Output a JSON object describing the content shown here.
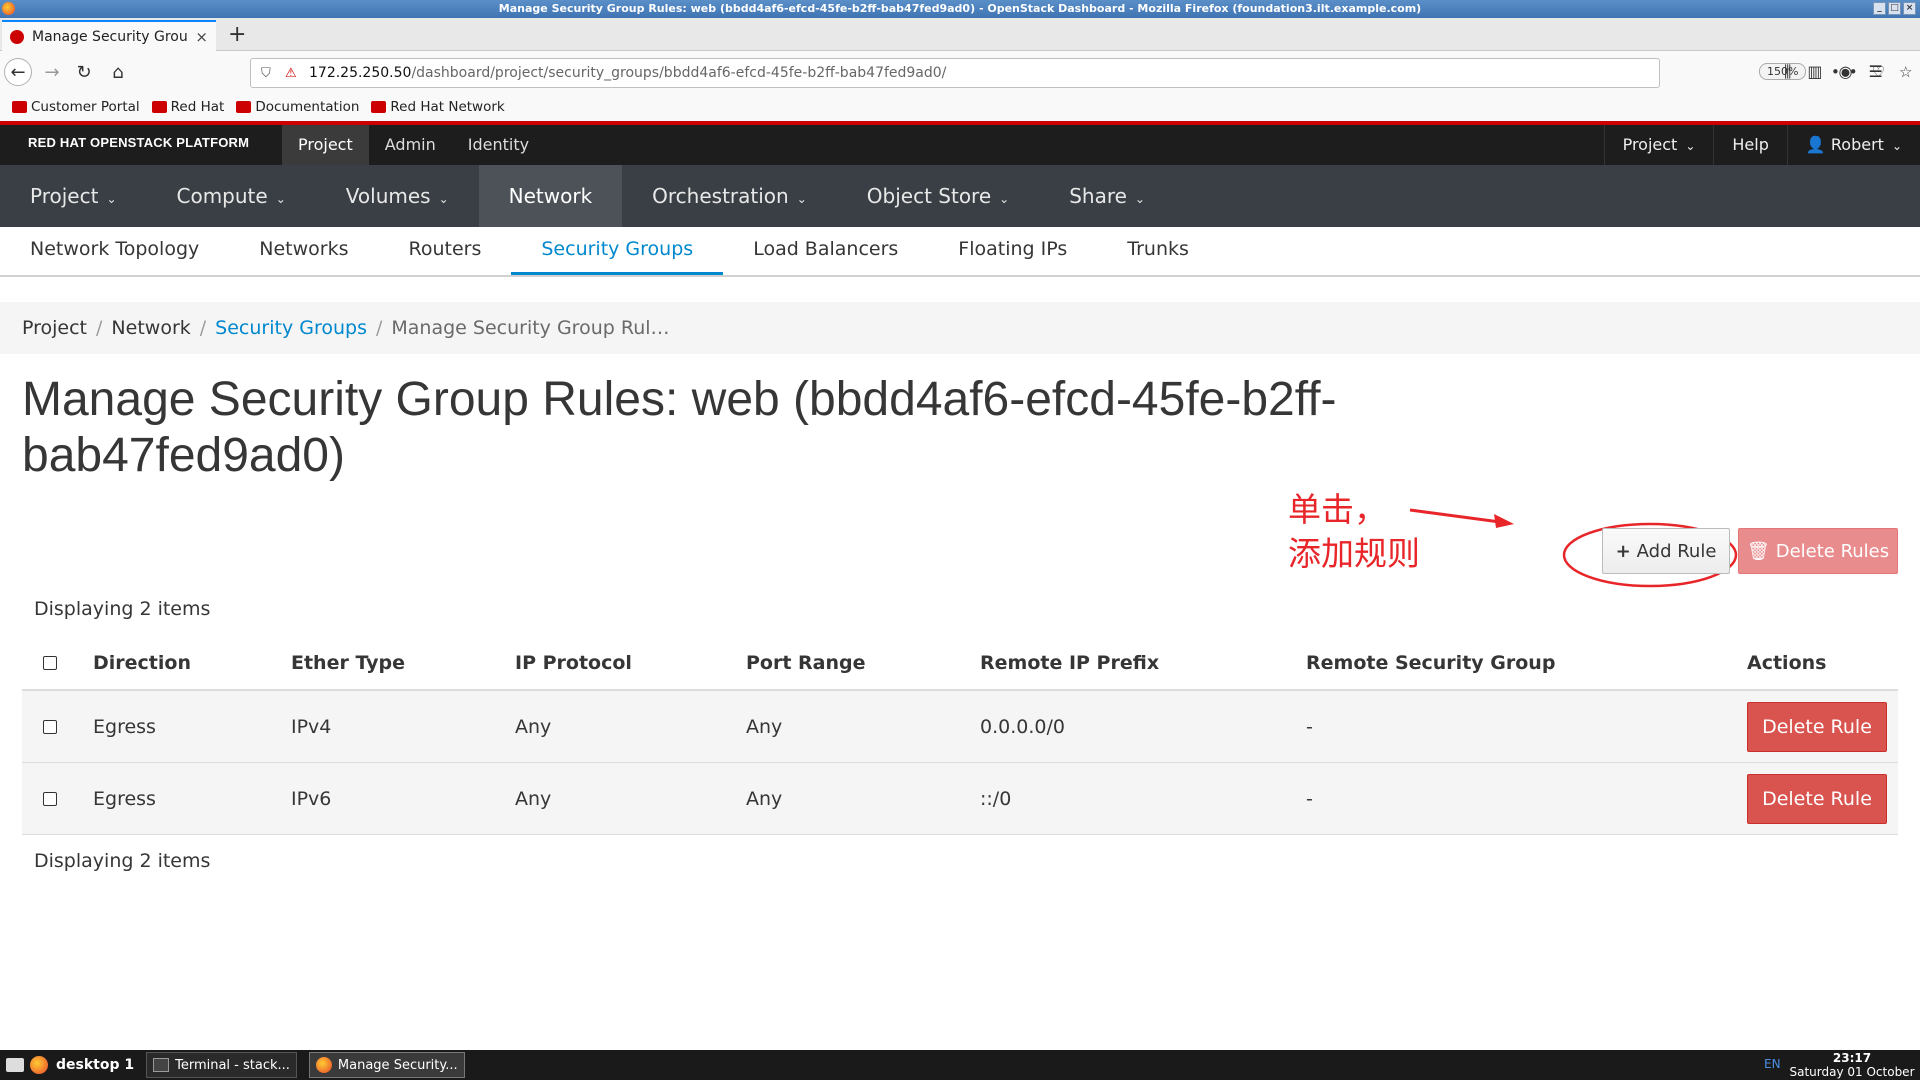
{
  "window": {
    "title": "Manage Security Group Rules: web (bbdd4af6-efcd-45fe-b2ff-bab47fed9ad0) - OpenStack Dashboard - Mozilla Firefox (foundation3.ilt.example.com)"
  },
  "browser": {
    "tab_title": "Manage Security Group Rules: web",
    "url_host": "172.25.250.50",
    "url_path": "/dashboard/project/security_groups/bbdd4af6-efcd-45fe-b2ff-bab47fed9ad0/",
    "zoom": "150%",
    "bookmarks": [
      "Customer Portal",
      "Red Hat",
      "Documentation",
      "Red Hat Network"
    ]
  },
  "masthead": {
    "brand": "RED HAT OPENSTACK PLATFORM",
    "tabs": [
      "Project",
      "Admin",
      "Identity"
    ],
    "right": {
      "project": "Project",
      "help": "Help",
      "user": "Robert"
    }
  },
  "mainnav": {
    "items": [
      {
        "label": "Project",
        "caret": true
      },
      {
        "label": "Compute",
        "caret": true
      },
      {
        "label": "Volumes",
        "caret": true
      },
      {
        "label": "Network",
        "caret": false,
        "active": true
      },
      {
        "label": "Orchestration",
        "caret": true
      },
      {
        "label": "Object Store",
        "caret": true
      },
      {
        "label": "Share",
        "caret": true
      }
    ]
  },
  "subnav": {
    "items": [
      "Network Topology",
      "Networks",
      "Routers",
      "Security Groups",
      "Load Balancers",
      "Floating IPs",
      "Trunks"
    ],
    "active": "Security Groups"
  },
  "breadcrumb": {
    "project": "Project",
    "network": "Network",
    "security_groups": "Security Groups",
    "current": "Manage Security Group Rul…"
  },
  "page": {
    "title_line1": "Manage Security Group Rules: web (bbdd4af6-efcd-45fe-b2ff-",
    "title_line2": "bab47fed9ad0)"
  },
  "annotation": {
    "line1": "单击，",
    "line2": "添加规则",
    "color": "#e8262a"
  },
  "actions": {
    "add_rule": "Add Rule",
    "delete_rules": "Delete Rules"
  },
  "table": {
    "count_text": "Displaying 2 items",
    "columns": [
      "Direction",
      "Ether Type",
      "IP Protocol",
      "Port Range",
      "Remote IP Prefix",
      "Remote Security Group",
      "Actions"
    ],
    "rows": [
      {
        "direction": "Egress",
        "ether_type": "IPv4",
        "ip_protocol": "Any",
        "port_range": "Any",
        "remote_ip_prefix": "0.0.0.0/0",
        "remote_security_group": "-",
        "action": "Delete Rule"
      },
      {
        "direction": "Egress",
        "ether_type": "IPv6",
        "ip_protocol": "Any",
        "port_range": "Any",
        "remote_ip_prefix": "::/0",
        "remote_security_group": "-",
        "action": "Delete Rule"
      }
    ]
  },
  "taskbar": {
    "desktop": "desktop 1",
    "tasks": [
      "Terminal - stack...",
      "Manage Security..."
    ],
    "lang": "EN",
    "time": "23:17",
    "date": "Saturday 01 October"
  }
}
